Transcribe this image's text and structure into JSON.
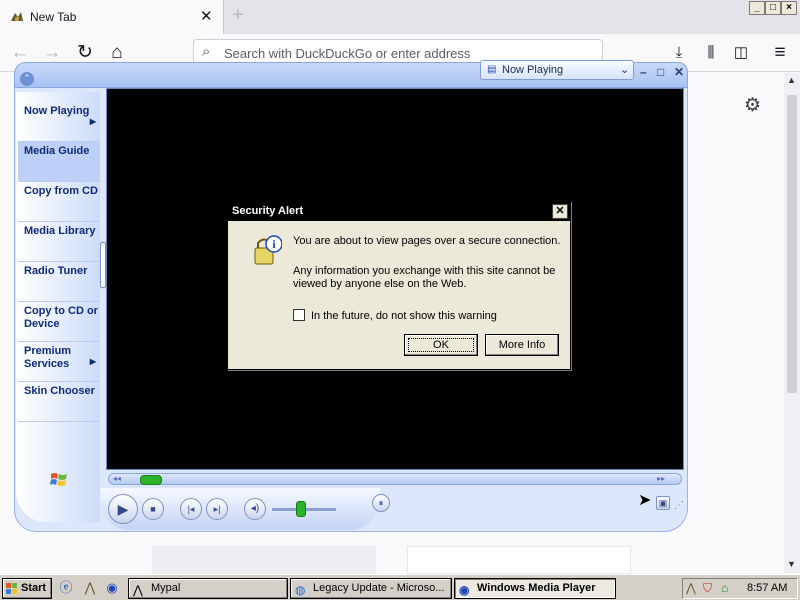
{
  "browser": {
    "tab_title": "New Tab",
    "new_tab_label": "+",
    "url_placeholder": "Search with DuckDuckGo or enter address",
    "window_buttons": [
      "_",
      "□",
      "×"
    ]
  },
  "wmp": {
    "now_playing_select": "Now Playing",
    "taskpane": [
      {
        "label": "Now Playing",
        "arrow": true
      },
      {
        "label": "Media Guide",
        "arrow": false,
        "selected": true
      },
      {
        "label": "Copy from CD",
        "arrow": false
      },
      {
        "label": "Media Library",
        "arrow": false
      },
      {
        "label": "Radio Tuner",
        "arrow": false
      },
      {
        "label": "Copy to CD or Device",
        "arrow": false
      },
      {
        "label": "Premium Services",
        "arrow": true
      },
      {
        "label": "Skin Chooser",
        "arrow": false
      }
    ],
    "volume_level": 0.45,
    "seek_position": 0.0
  },
  "dialog": {
    "title": "Security Alert",
    "message1": "You are about to view pages over a secure connection.",
    "message2_line1": "Any information you exchange with this site cannot be",
    "message2_line2": "viewed by anyone else on the Web.",
    "checkbox_label": "In the future, do not show this warning",
    "checkbox_checked": false,
    "ok_label": "OK",
    "more_info_label": "More Info"
  },
  "taskbar": {
    "start_label": "Start",
    "buttons": [
      {
        "label": "Mypal",
        "active": false
      },
      {
        "label": "Legacy Update - Microso...",
        "active": false
      },
      {
        "label": "Windows Media Player",
        "active": true
      }
    ],
    "clock": "8:57 AM"
  },
  "colors": {
    "wmp_accent": "#0c2a78",
    "wmp_frame": "#dce7fb",
    "xp_taskbar": "#d4d0c8",
    "dialog_bg": "#ece9d8"
  }
}
